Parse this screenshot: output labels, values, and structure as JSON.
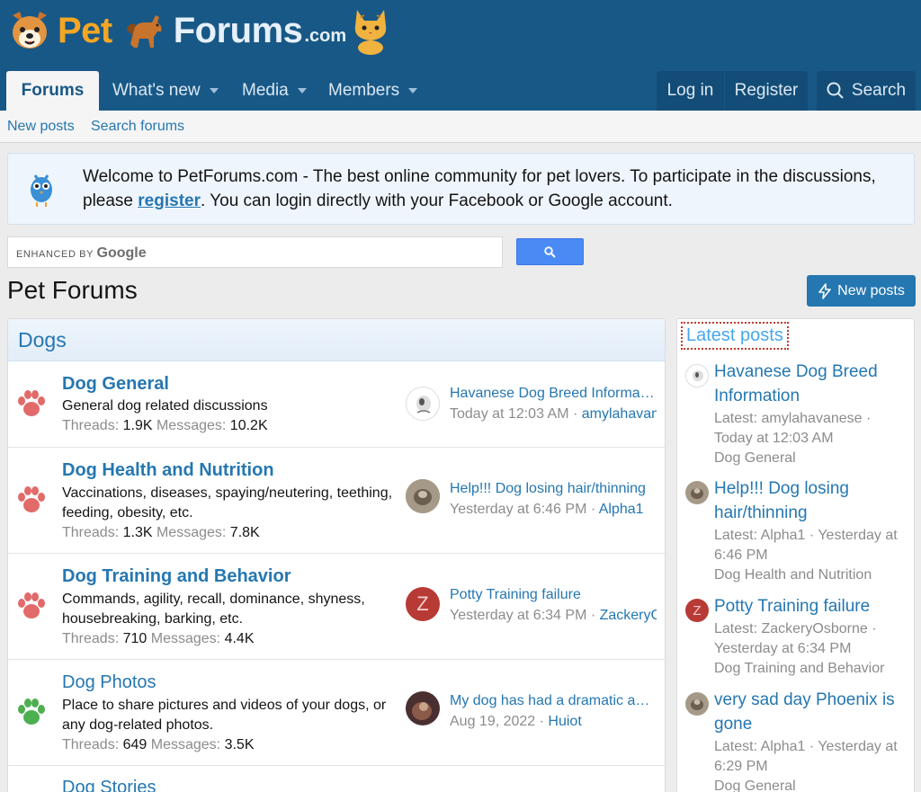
{
  "brand": {
    "pet": "Pet",
    "forums": "Forums",
    "com": ".com"
  },
  "nav": {
    "tabs": [
      {
        "label": "Forums"
      },
      {
        "label": "What's new"
      },
      {
        "label": "Media"
      },
      {
        "label": "Members"
      }
    ],
    "login": "Log in",
    "register": "Register",
    "search": "Search"
  },
  "subnav": {
    "new_posts": "New posts",
    "search_forums": "Search forums"
  },
  "notice": {
    "text_before": "Welcome to PetForums.com - The best online community for pet lovers. To participate in the discussions, please ",
    "link": "register",
    "text_after": ". You can login directly with your Facebook or Google account."
  },
  "search": {
    "enhanced_by": "ENHANCED BY",
    "google": "Google"
  },
  "page_title": "Pet Forums",
  "new_posts_button": "New posts",
  "category": {
    "title": "Dogs",
    "nodes": [
      {
        "title": "Dog General",
        "description": "General dog related discussions",
        "threads_label": "Threads:",
        "threads": "1.9K",
        "messages_label": "Messages:",
        "messages": "10.2K",
        "last_title": "Havanese Dog Breed Information",
        "last_time": "Today at 12:03 AM",
        "last_user": "amylahavanese"
      },
      {
        "title": "Dog Health and Nutrition",
        "description": "Vaccinations, diseases, spaying/neutering, teething, feeding, obesity, etc.",
        "threads_label": "Threads:",
        "threads": "1.3K",
        "messages_label": "Messages:",
        "messages": "7.8K",
        "last_title": "Help!!! Dog losing hair/thinning",
        "last_time": "Yesterday at 6:46 PM",
        "last_user": "Alpha1"
      },
      {
        "title": "Dog Training and Behavior",
        "description": "Commands, agility, recall, dominance, shyness, housebreaking, barking, etc.",
        "threads_label": "Threads:",
        "threads": "710",
        "messages_label": "Messages:",
        "messages": "4.4K",
        "last_title": "Potty Training failure",
        "last_time": "Yesterday at 6:34 PM",
        "last_user": "ZackeryOsborne",
        "last_avatar_letter": "Z"
      },
      {
        "title": "Dog Photos",
        "description": "Place to share pictures and videos of your dogs, or any dog-related photos.",
        "threads_label": "Threads:",
        "threads": "649",
        "messages_label": "Messages:",
        "messages": "3.5K",
        "last_title": "My dog has had a dramatic appearance change",
        "last_time": "Aug 19, 2022",
        "last_user": "Huiot"
      },
      {
        "title": "Dog Stories"
      }
    ]
  },
  "sidebar": {
    "title": "Latest posts",
    "items": [
      {
        "title": "Havanese Dog Breed Information",
        "meta": "Latest: amylahavanese · Today at 12:03 AM",
        "forum": "Dog General"
      },
      {
        "title": "Help!!! Dog losing hair/thinning",
        "meta": "Latest: Alpha1 · Yesterday at 6:46 PM",
        "forum": "Dog Health and Nutrition"
      },
      {
        "title": "Potty Training failure",
        "meta": "Latest: ZackeryOsborne · Yesterday at 6:34 PM",
        "forum": "Dog Training and Behavior",
        "avatar_letter": "Z"
      },
      {
        "title": "very sad day Phoenix is gone",
        "meta": "Latest: Alpha1 · Yesterday at 6:29 PM",
        "forum": "Dog General"
      }
    ]
  },
  "colors": {
    "header": "#185886",
    "link": "#2577b1",
    "paw_red": "#e26a6a",
    "paw_green": "#4caf50",
    "avatar_red": "#b83a35"
  }
}
